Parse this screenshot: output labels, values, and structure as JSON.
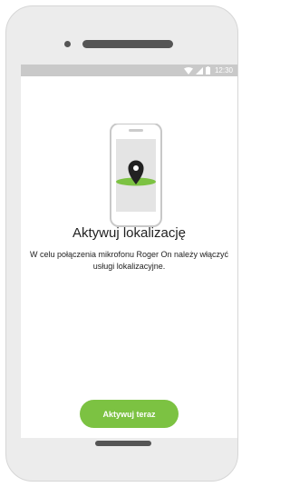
{
  "statusbar": {
    "time": "12:30",
    "icons": [
      "wifi-icon",
      "signal-icon",
      "battery-icon"
    ]
  },
  "illustration": {
    "icon": "location-pin-icon",
    "accent_color": "#7cc242"
  },
  "content": {
    "title": "Aktywuj lokalizację",
    "description": "W celu połączenia mikrofonu Roger On należy włączyć usługi lokalizacyjne."
  },
  "actions": {
    "activate_label": "Aktywuj teraz"
  },
  "colors": {
    "accent": "#7cc242",
    "statusbar": "#c9c9c9",
    "frame": "#ececec"
  }
}
